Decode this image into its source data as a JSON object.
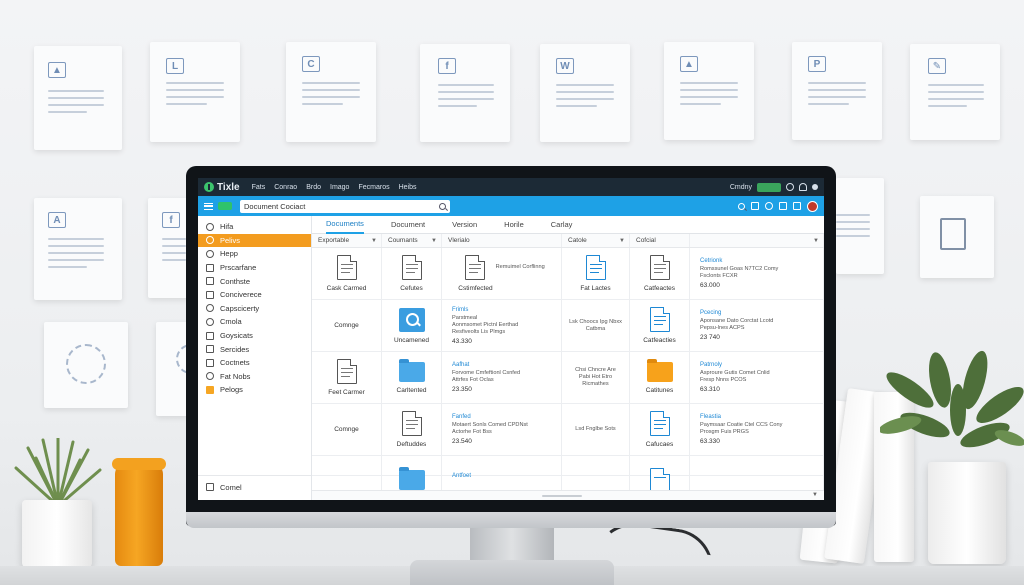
{
  "app": {
    "name": "Tixle",
    "menu": [
      "Fats",
      "Conrao",
      "Brdo",
      "Imago",
      "Fecmaros",
      "Heibs"
    ],
    "status_label": "Cmdny",
    "status_chip": ""
  },
  "toolbar": {
    "search_value": "Document Cociact"
  },
  "sidebar": {
    "items": [
      {
        "label": "Hifa"
      },
      {
        "label": "Pelivs"
      },
      {
        "label": "Hepp"
      },
      {
        "label": "Prscarfane"
      },
      {
        "label": "Conthste"
      },
      {
        "label": "Conciverece"
      },
      {
        "label": "Capscicerty"
      },
      {
        "label": "Cmola"
      },
      {
        "label": "Goysicats"
      },
      {
        "label": "Sercides"
      },
      {
        "label": "Coctnets"
      },
      {
        "label": "Fat Nobs"
      },
      {
        "label": "Pelogs"
      }
    ],
    "footer": "Comel"
  },
  "tabs": [
    "Documents",
    "Document",
    "Version",
    "Horile",
    "Carlay"
  ],
  "columns": [
    "Exportable",
    "Coumants",
    "Vlerialo",
    "Catole",
    "Cofcial"
  ],
  "rows": [
    {
      "c1": {
        "label": "Cask Carmed"
      },
      "c2": {
        "label": "Cefutes"
      },
      "c3": {
        "label": "Cstimfected",
        "note": "Remuimel Corflinng"
      },
      "c4": {
        "label": "Fat Lactes"
      },
      "c5": {
        "label": "Catfeactes"
      },
      "c6": {
        "title": "Cetrionk",
        "line1": "Romssunel Goas N7TC2 Comy",
        "line2": "Fsclonts FCXR",
        "num": "63.000"
      }
    },
    {
      "c1": {
        "label": "Comnge"
      },
      "c2": {
        "label": "Uncamened"
      },
      "c3": {
        "title": "Frimls",
        "line1": "Parstmeal",
        "line2": "Aonmsomet Pictnl Eerthad",
        "line3": "Resfiveolts Lis Plmgs",
        "num": "43.330"
      },
      "c4": {
        "line1": "Lsk Choocs Ipg Nbxx",
        "line2": "Catbma"
      },
      "c5": {
        "label": "Catfeacties"
      },
      "c6": {
        "title": "Pcecing",
        "line1": "Aponsane Dato Corctat Lcotd",
        "line2": "Pepsu-lnes ACPS",
        "num": "23 740"
      }
    },
    {
      "c1": {
        "label": "Feet Carmer"
      },
      "c2": {
        "label": "Carltented"
      },
      "c3": {
        "title": "Aafhat",
        "line1": "Forvome Cmfeftionl Csnfed",
        "line2": "Attrfes Fot Oclas",
        "num": "23.350"
      },
      "c4": {
        "line1": "Chsi Chncre Are",
        "line2": "Pabi Hot Etro",
        "line3": "Ricmathes"
      },
      "c5": {
        "label": "Catitunes"
      },
      "c6": {
        "title": "Patrnoly",
        "line1": "Asproure Gutis Comet Cnlid",
        "line2": "Fresp Nnns PCOS",
        "num": "63.310"
      }
    },
    {
      "c1": {
        "label": "Comnge"
      },
      "c2": {
        "label": "Deftuddes"
      },
      "c3": {
        "title": "Fanfed",
        "line1": "Motaert Sonls Comed CPDNst",
        "line2": "Actorhe Fot Bss",
        "num": "23.540"
      },
      "c4": {
        "line1": "Lsd Fnglbe Sots"
      },
      "c5": {
        "label": "Cafucaes"
      },
      "c6": {
        "title": "Fleastia",
        "line1": "Paymsaar Coatie Ctel CCS Cony",
        "line2": "Prosgm Fuis PRGS",
        "num": "63.330"
      }
    },
    {
      "c1": {
        "label": ""
      },
      "c2": {
        "label": ""
      },
      "c3": {
        "title": "Antfoet"
      },
      "c4": {
        "label": ""
      },
      "c5": {
        "label": ""
      },
      "c6": {
        "title": ""
      }
    }
  ],
  "colors": {
    "titlebar": "#1c2a36",
    "toolbar": "#1ea1e6",
    "active_sidebar": "#f39c1f",
    "accent": "#1e88d4"
  }
}
